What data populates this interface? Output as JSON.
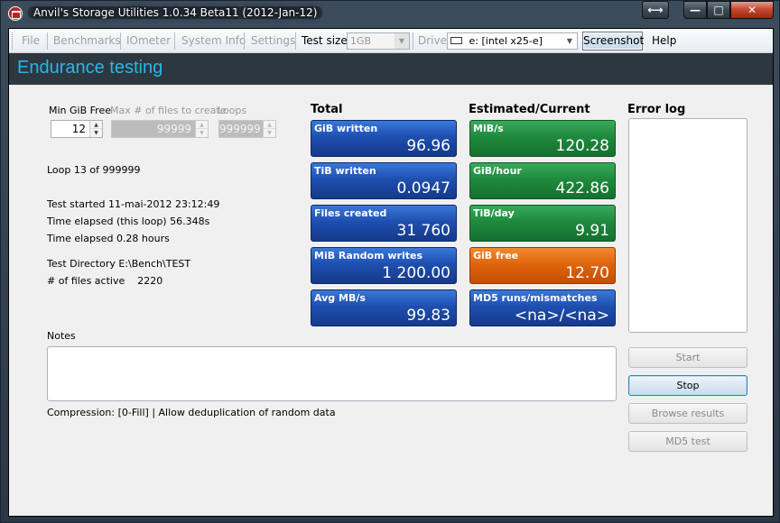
{
  "window": {
    "title": "Anvil's Storage Utilities 1.0.34 Beta11 (2012-Jan-12)",
    "extra_button": "⟷",
    "min": "—",
    "max": "□",
    "close": "✕"
  },
  "menu": {
    "file": "File",
    "benchmarks": "Benchmarks",
    "iometer": "IOmeter",
    "system_info": "System Info",
    "settings": "Settings",
    "test_size_label": "Test size",
    "test_size_value": "1GB",
    "drive_label": "Drive",
    "drive_value": "e: [intel x25-e]",
    "screenshot": "Screenshot",
    "help": "Help"
  },
  "header": {
    "title": "Endurance testing"
  },
  "params": {
    "min_gib_free_label": "Min GiB Free",
    "min_gib_free_value": "12",
    "max_files_label": "Max # of files to create",
    "max_files_value": "99999",
    "loops_label": "Loops",
    "loops_value": "999999"
  },
  "status": {
    "loop": "Loop 13 of 999999",
    "test_started": "Test started 11-mai-2012 23:12:49",
    "elapsed_loop": "Time elapsed (this loop) 56.348s",
    "elapsed_hours": "Time elapsed 0.28 hours",
    "test_directory": "Test Directory E:\\Bench\\TEST",
    "files_active": "# of files active    2220"
  },
  "totals": {
    "heading": "Total",
    "tiles": [
      {
        "label": "GiB written",
        "value": "96.96"
      },
      {
        "label": "TiB written",
        "value": "0.0947"
      },
      {
        "label": "Files created",
        "value": "31 760"
      },
      {
        "label": "MiB Random writes",
        "value": "1 200.00"
      },
      {
        "label": "Avg MB/s",
        "value": "99.83"
      }
    ]
  },
  "estimated": {
    "heading": "Estimated/Current",
    "tiles": [
      {
        "label": "MiB/s",
        "value": "120.28",
        "color": "#1f8a3e"
      },
      {
        "label": "GiB/hour",
        "value": "422.86",
        "color": "#1f8a3e"
      },
      {
        "label": "TiB/day",
        "value": "9.91",
        "color": "#1f8a3e"
      },
      {
        "label": "GiB free",
        "value": "12.70",
        "color": "#e0650c"
      },
      {
        "label": "MD5 runs/mismatches",
        "value": "<na>/<na>",
        "color": "#1e4fb0"
      }
    ]
  },
  "error_log": {
    "heading": "Error log"
  },
  "notes": {
    "label": "Notes",
    "compression": "Compression: [0-Fill] | Allow deduplication of random data"
  },
  "buttons": {
    "start": "Start",
    "stop": "Stop",
    "browse_results": "Browse results",
    "md5_test": "MD5 test"
  },
  "colors": {
    "header_bg": "#2d3740",
    "header_title": "#29b6e8",
    "tile_blue": "#1e4fb0",
    "tile_green": "#1f8a3e",
    "tile_orange": "#e0650c"
  }
}
